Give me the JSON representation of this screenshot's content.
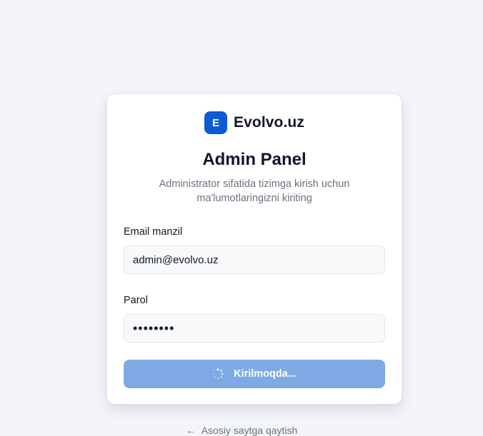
{
  "brand": {
    "logo_letter": "E",
    "name": "Evolvo.uz",
    "logo_color": "#0b5bd3"
  },
  "header": {
    "title": "Admin Panel",
    "subtitle": "Administrator sifatida tizimga kirish uchun ma'lumotlaringizni kiriting"
  },
  "form": {
    "email": {
      "label": "Email manzil",
      "value": "admin@evolvo.uz"
    },
    "password": {
      "label": "Parol",
      "value": "••••••••"
    },
    "submit": {
      "label": "Kirilmoqda...",
      "icon": "spinner-icon",
      "color": "#7ea9e4"
    }
  },
  "footer": {
    "back_arrow": "←",
    "back_label": "Asosiy saytga qaytish"
  }
}
